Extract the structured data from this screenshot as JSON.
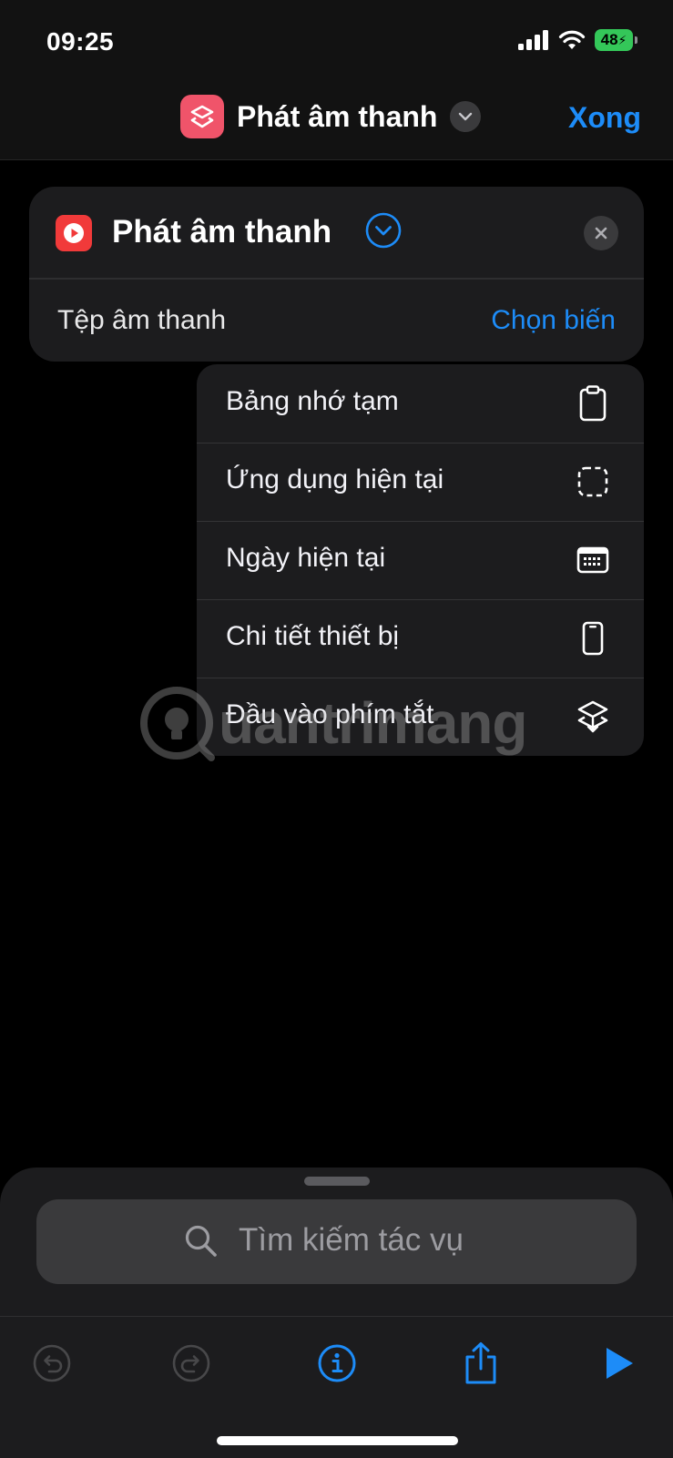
{
  "status": {
    "time": "09:25",
    "battery": "48"
  },
  "nav": {
    "title": "Phát âm thanh",
    "done_label": "Xong"
  },
  "action": {
    "title": "Phát âm thanh",
    "param_label": "Tệp âm thanh",
    "param_value": "Chọn biến"
  },
  "menu": {
    "items": [
      {
        "label": "Bảng nhớ tạm",
        "icon": "clipboard-icon"
      },
      {
        "label": "Ứng dụng hiện tại",
        "icon": "app-frame-icon"
      },
      {
        "label": "Ngày hiện tại",
        "icon": "calendar-icon"
      },
      {
        "label": "Chi tiết thiết bị",
        "icon": "phone-icon"
      },
      {
        "label": "Đầu vào phím tắt",
        "icon": "shortcuts-icon"
      }
    ]
  },
  "watermark": {
    "text": "uantrimang"
  },
  "search": {
    "placeholder": "Tìm kiếm tác vụ"
  },
  "colors": {
    "accent": "#1d8cf8",
    "background": "#000000",
    "card": "#1c1c1e",
    "battery": "#34c759",
    "app_icon": "#f0546a",
    "action_icon": "#f13a3a"
  }
}
